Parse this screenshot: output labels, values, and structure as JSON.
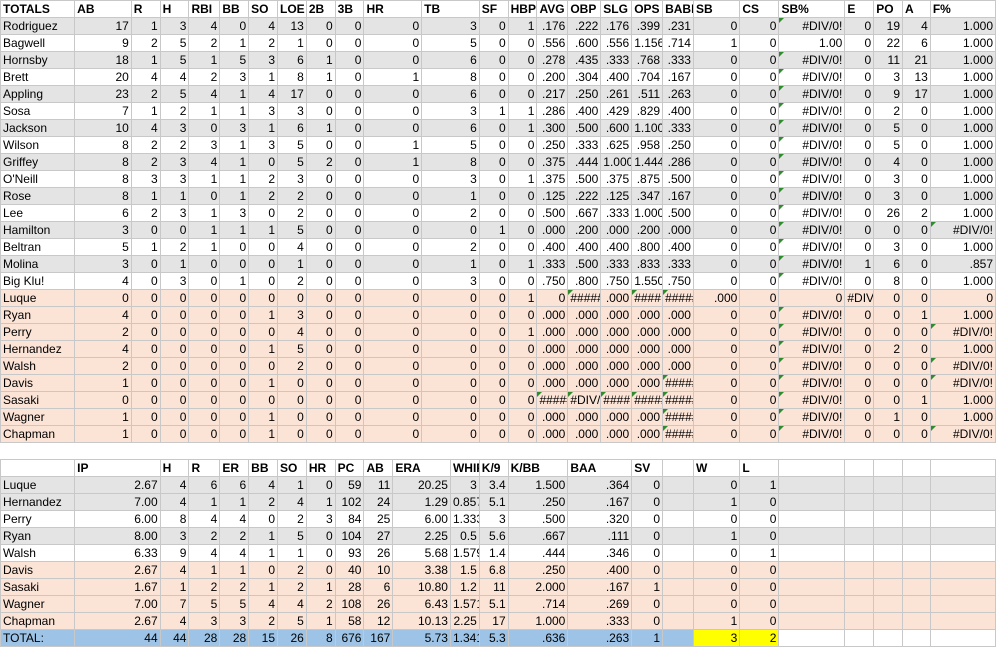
{
  "batting": {
    "headers": [
      "TOTALS",
      "AB",
      "R",
      "H",
      "RBI",
      "BB",
      "SO",
      "LOE",
      "2B",
      "3B",
      "HR",
      "TB",
      "SF",
      "HBP",
      "AVG",
      "OBP",
      "SLG",
      "OPS",
      "BABIP",
      "SB",
      "CS",
      "SB%",
      "E",
      "PO",
      "A",
      "F%"
    ],
    "rows": [
      {
        "s": "gray",
        "c": [
          "Rodriguez",
          "17",
          "1",
          "3",
          "4",
          "0",
          "4",
          "13",
          "0",
          "0",
          "0",
          "3",
          "0",
          "1",
          ".176",
          ".222",
          ".176",
          ".399",
          ".231",
          "0",
          "0",
          "#DIV/0!",
          "0",
          "19",
          "4",
          "1.000"
        ]
      },
      {
        "s": "blank",
        "c": [
          "Bagwell",
          "9",
          "2",
          "5",
          "2",
          "1",
          "2",
          "1",
          "0",
          "0",
          "0",
          "5",
          "0",
          "0",
          ".556",
          ".600",
          ".556",
          "1.156",
          ".714",
          "1",
          "0",
          "1.00",
          "0",
          "22",
          "6",
          "1.000"
        ]
      },
      {
        "s": "gray",
        "c": [
          "Hornsby",
          "18",
          "1",
          "5",
          "1",
          "5",
          "3",
          "6",
          "1",
          "0",
          "0",
          "6",
          "0",
          "0",
          ".278",
          ".435",
          ".333",
          ".768",
          ".333",
          "0",
          "0",
          "#DIV/0!",
          "0",
          "11",
          "21",
          "1.000"
        ]
      },
      {
        "s": "blank",
        "c": [
          "Brett",
          "20",
          "4",
          "4",
          "2",
          "3",
          "1",
          "8",
          "1",
          "0",
          "1",
          "8",
          "0",
          "0",
          ".200",
          ".304",
          ".400",
          ".704",
          ".167",
          "0",
          "0",
          "#DIV/0!",
          "0",
          "3",
          "13",
          "1.000"
        ]
      },
      {
        "s": "gray",
        "c": [
          "Appling",
          "23",
          "2",
          "5",
          "4",
          "1",
          "4",
          "17",
          "0",
          "0",
          "0",
          "6",
          "0",
          "0",
          ".217",
          ".250",
          ".261",
          ".511",
          ".263",
          "0",
          "0",
          "#DIV/0!",
          "0",
          "9",
          "17",
          "1.000"
        ]
      },
      {
        "s": "blank",
        "c": [
          "Sosa",
          "7",
          "1",
          "2",
          "1",
          "1",
          "3",
          "3",
          "0",
          "0",
          "0",
          "3",
          "1",
          "1",
          ".286",
          ".400",
          ".429",
          ".829",
          ".400",
          "0",
          "0",
          "#DIV/0!",
          "0",
          "2",
          "0",
          "1.000"
        ]
      },
      {
        "s": "gray",
        "c": [
          "Jackson",
          "10",
          "4",
          "3",
          "0",
          "3",
          "1",
          "6",
          "1",
          "0",
          "0",
          "6",
          "0",
          "1",
          ".300",
          ".500",
          ".600",
          "1.100",
          ".333",
          "0",
          "0",
          "#DIV/0!",
          "0",
          "5",
          "0",
          "1.000"
        ]
      },
      {
        "s": "blank",
        "c": [
          "Wilson",
          "8",
          "2",
          "2",
          "3",
          "1",
          "3",
          "5",
          "0",
          "0",
          "1",
          "5",
          "0",
          "0",
          ".250",
          ".333",
          ".625",
          ".958",
          ".250",
          "0",
          "0",
          "#DIV/0!",
          "0",
          "5",
          "0",
          "1.000"
        ]
      },
      {
        "s": "gray",
        "c": [
          "Griffey",
          "8",
          "2",
          "3",
          "4",
          "1",
          "0",
          "5",
          "2",
          "0",
          "1",
          "8",
          "0",
          "0",
          ".375",
          ".444",
          "1.000",
          "1.444",
          ".286",
          "0",
          "0",
          "#DIV/0!",
          "0",
          "4",
          "0",
          "1.000"
        ]
      },
      {
        "s": "blank",
        "c": [
          "O'Neill",
          "8",
          "3",
          "3",
          "1",
          "1",
          "2",
          "3",
          "0",
          "0",
          "0",
          "3",
          "0",
          "1",
          ".375",
          ".500",
          ".375",
          ".875",
          ".500",
          "0",
          "0",
          "#DIV/0!",
          "0",
          "3",
          "0",
          "1.000"
        ]
      },
      {
        "s": "gray",
        "c": [
          "Rose",
          "8",
          "1",
          "1",
          "0",
          "1",
          "2",
          "2",
          "0",
          "0",
          "0",
          "1",
          "0",
          "0",
          ".125",
          ".222",
          ".125",
          ".347",
          ".167",
          "0",
          "0",
          "#DIV/0!",
          "0",
          "3",
          "0",
          "1.000"
        ]
      },
      {
        "s": "blank",
        "c": [
          "Lee",
          "6",
          "2",
          "3",
          "1",
          "3",
          "0",
          "2",
          "0",
          "0",
          "0",
          "2",
          "0",
          "0",
          ".500",
          ".667",
          ".333",
          "1.000",
          ".500",
          "0",
          "0",
          "#DIV/0!",
          "0",
          "26",
          "2",
          "1.000"
        ]
      },
      {
        "s": "gray",
        "c": [
          "Hamilton",
          "3",
          "0",
          "0",
          "1",
          "1",
          "1",
          "5",
          "0",
          "0",
          "0",
          "0",
          "1",
          "0",
          ".000",
          ".200",
          ".000",
          ".200",
          ".000",
          "0",
          "0",
          "#DIV/0!",
          "0",
          "0",
          "0",
          "#DIV/0!"
        ]
      },
      {
        "s": "blank",
        "c": [
          "Beltran",
          "5",
          "1",
          "2",
          "1",
          "0",
          "0",
          "4",
          "0",
          "0",
          "0",
          "2",
          "0",
          "0",
          ".400",
          ".400",
          ".400",
          ".800",
          ".400",
          "0",
          "0",
          "#DIV/0!",
          "0",
          "3",
          "0",
          "1.000"
        ]
      },
      {
        "s": "gray",
        "c": [
          "Molina",
          "3",
          "0",
          "1",
          "0",
          "0",
          "0",
          "1",
          "0",
          "0",
          "0",
          "1",
          "0",
          "1",
          ".333",
          ".500",
          ".333",
          ".833",
          ".333",
          "0",
          "0",
          "#DIV/0!",
          "1",
          "6",
          "0",
          ".857"
        ]
      },
      {
        "s": "blank",
        "c": [
          "Big Klu!",
          "4",
          "0",
          "3",
          "0",
          "1",
          "0",
          "2",
          "0",
          "0",
          "0",
          "3",
          "0",
          "0",
          ".750",
          ".800",
          ".750",
          "1.550",
          ".750",
          "0",
          "0",
          "#DIV/0!",
          "0",
          "8",
          "0",
          "1.000"
        ]
      },
      {
        "s": "peach",
        "c": [
          "Luque",
          "0",
          "0",
          "0",
          "0",
          "0",
          "0",
          "0",
          "0",
          "0",
          "0",
          "0",
          "0",
          "1",
          "0",
          "#####",
          ".000",
          "####",
          "#####",
          ".000",
          "0",
          "0",
          "#DIV/0!",
          "0",
          "0",
          "0",
          "#DIV/0!"
        ]
      },
      {
        "s": "peach",
        "c": [
          "Ryan",
          "4",
          "0",
          "0",
          "0",
          "0",
          "1",
          "3",
          "0",
          "0",
          "0",
          "0",
          "0",
          "0",
          ".000",
          ".000",
          ".000",
          ".000",
          ".000",
          "0",
          "0",
          "#DIV/0!",
          "0",
          "0",
          "1",
          "1.000"
        ]
      },
      {
        "s": "peach",
        "c": [
          "Perry",
          "2",
          "0",
          "0",
          "0",
          "0",
          "0",
          "4",
          "0",
          "0",
          "0",
          "0",
          "0",
          "1",
          ".000",
          ".000",
          ".000",
          ".000",
          ".000",
          "0",
          "0",
          "#DIV/0!",
          "0",
          "0",
          "0",
          "#DIV/0!"
        ]
      },
      {
        "s": "peach",
        "c": [
          "Hernandez",
          "4",
          "0",
          "0",
          "0",
          "0",
          "1",
          "5",
          "0",
          "0",
          "0",
          "0",
          "0",
          "0",
          ".000",
          ".000",
          ".000",
          ".000",
          ".000",
          "0",
          "0",
          "#DIV/0!",
          "0",
          "2",
          "0",
          "1.000"
        ]
      },
      {
        "s": "peach",
        "c": [
          "Walsh",
          "2",
          "0",
          "0",
          "0",
          "0",
          "0",
          "2",
          "0",
          "0",
          "0",
          "0",
          "0",
          "0",
          ".000",
          ".000",
          ".000",
          ".000",
          ".000",
          "0",
          "0",
          "#DIV/0!",
          "0",
          "0",
          "0",
          "#DIV/0!"
        ]
      },
      {
        "s": "peach",
        "c": [
          "Davis",
          "1",
          "0",
          "0",
          "0",
          "0",
          "1",
          "0",
          "0",
          "0",
          "0",
          "0",
          "0",
          "0",
          ".000",
          ".000",
          ".000",
          ".000",
          "#####",
          "0",
          "0",
          "#DIV/0!",
          "0",
          "0",
          "0",
          "#DIV/0!"
        ]
      },
      {
        "s": "peach",
        "c": [
          "Sasaki",
          "0",
          "0",
          "0",
          "0",
          "0",
          "0",
          "0",
          "0",
          "0",
          "0",
          "0",
          "0",
          "0",
          "#####",
          "#DIV/0!",
          "####",
          "#####",
          "#####",
          "0",
          "0",
          "#DIV/0!",
          "0",
          "0",
          "1",
          "1.000"
        ]
      },
      {
        "s": "peach",
        "c": [
          "Wagner",
          "1",
          "0",
          "0",
          "0",
          "0",
          "1",
          "0",
          "0",
          "0",
          "0",
          "0",
          "0",
          "0",
          ".000",
          ".000",
          ".000",
          ".000",
          "#####",
          "0",
          "0",
          "#DIV/0!",
          "0",
          "1",
          "0",
          "1.000"
        ]
      },
      {
        "s": "peach",
        "c": [
          "Chapman",
          "1",
          "0",
          "0",
          "0",
          "0",
          "1",
          "0",
          "0",
          "0",
          "0",
          "0",
          "0",
          "0",
          ".000",
          ".000",
          ".000",
          ".000",
          "#####",
          "0",
          "0",
          "#DIV/0!",
          "0",
          "0",
          "0",
          "#DIV/0!"
        ]
      }
    ]
  },
  "pitching": {
    "headers": [
      "",
      "IP",
      "H",
      "R",
      "ER",
      "BB",
      "SO",
      "HR",
      "PC",
      "AB",
      "ERA",
      "WHIP",
      "K/9",
      "K/BB",
      "BAA",
      "SV",
      "W",
      "L"
    ],
    "rows": [
      {
        "s": "gray",
        "c": [
          "Luque",
          "2.67",
          "4",
          "6",
          "6",
          "4",
          "1",
          "0",
          "59",
          "11",
          "20.25",
          "3",
          "3.4",
          "1.500",
          ".364",
          "0",
          "0",
          "1"
        ]
      },
      {
        "s": "gray",
        "c": [
          "Hernandez",
          "7.00",
          "4",
          "1",
          "1",
          "2",
          "4",
          "1",
          "102",
          "24",
          "1.29",
          "0.857",
          "5.1",
          ".250",
          ".167",
          "0",
          "1",
          "0"
        ]
      },
      {
        "s": "blank",
        "c": [
          "Perry",
          "6.00",
          "8",
          "4",
          "4",
          "0",
          "2",
          "3",
          "84",
          "25",
          "6.00",
          "1.333",
          "3",
          ".500",
          ".320",
          "0",
          "0",
          "0"
        ]
      },
      {
        "s": "gray",
        "c": [
          "Ryan",
          "8.00",
          "3",
          "2",
          "2",
          "1",
          "5",
          "0",
          "104",
          "27",
          "2.25",
          "0.5",
          "5.6",
          ".667",
          ".111",
          "0",
          "1",
          "0"
        ]
      },
      {
        "s": "blank",
        "c": [
          "Walsh",
          "6.33",
          "9",
          "4",
          "4",
          "1",
          "1",
          "0",
          "93",
          "26",
          "5.68",
          "1.579",
          "1.4",
          ".444",
          ".346",
          "0",
          "0",
          "1"
        ]
      },
      {
        "s": "peach",
        "c": [
          "Davis",
          "2.67",
          "4",
          "1",
          "1",
          "0",
          "2",
          "0",
          "40",
          "10",
          "3.38",
          "1.5",
          "6.8",
          ".250",
          ".400",
          "0",
          "0",
          "0"
        ]
      },
      {
        "s": "peach",
        "c": [
          "Sasaki",
          "1.67",
          "1",
          "2",
          "2",
          "1",
          "2",
          "1",
          "28",
          "6",
          "10.80",
          "1.2",
          "11",
          "2.000",
          ".167",
          "1",
          "0",
          "0"
        ]
      },
      {
        "s": "peach",
        "c": [
          "Wagner",
          "7.00",
          "7",
          "5",
          "5",
          "4",
          "4",
          "2",
          "108",
          "26",
          "6.43",
          "1.571",
          "5.1",
          ".714",
          ".269",
          "0",
          "0",
          "0"
        ]
      },
      {
        "s": "peach",
        "c": [
          "Chapman",
          "2.67",
          "4",
          "3",
          "3",
          "2",
          "5",
          "1",
          "58",
          "12",
          "10.13",
          "2.25",
          "17",
          "1.000",
          ".333",
          "0",
          "1",
          "0"
        ]
      },
      {
        "s": "total",
        "c": [
          "TOTAL:",
          "44",
          "44",
          "28",
          "28",
          "15",
          "26",
          "8",
          "676",
          "167",
          "5.73",
          "1.341",
          "5.3",
          ".636",
          ".263",
          "1",
          "3",
          "2"
        ]
      }
    ]
  }
}
